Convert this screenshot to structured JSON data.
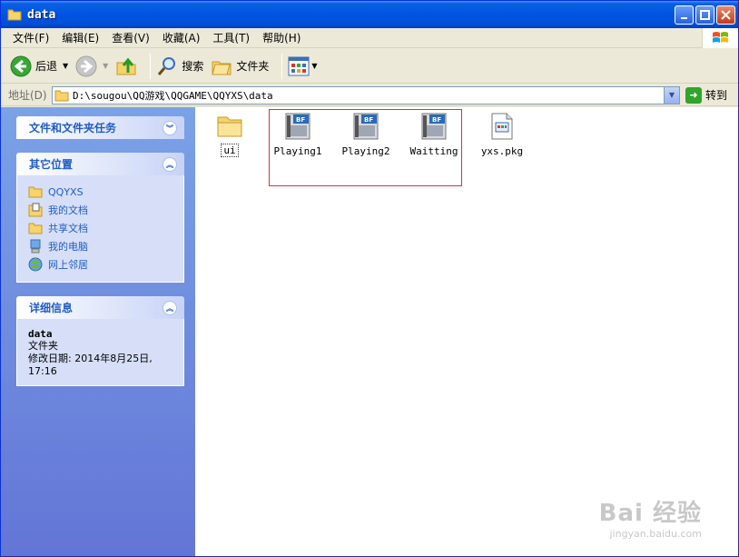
{
  "window": {
    "title": "data"
  },
  "menu": {
    "items": [
      "文件(F)",
      "编辑(E)",
      "查看(V)",
      "收藏(A)",
      "工具(T)",
      "帮助(H)"
    ]
  },
  "toolbar": {
    "back_label": "后退",
    "search_label": "搜索",
    "folders_label": "文件夹"
  },
  "address": {
    "label": "地址(D)",
    "path": "D:\\sougou\\QQ游戏\\QQGAME\\QQYXS\\data",
    "go_label": "转到"
  },
  "tasks_panel": {
    "title": "文件和文件夹任务"
  },
  "places_panel": {
    "title": "其它位置",
    "items": [
      {
        "label": "QQYXS",
        "icon": "folder-icon"
      },
      {
        "label": "我的文档",
        "icon": "my-documents-icon"
      },
      {
        "label": "共享文档",
        "icon": "shared-documents-icon"
      },
      {
        "label": "我的电脑",
        "icon": "my-computer-icon"
      },
      {
        "label": "网上邻居",
        "icon": "network-places-icon"
      }
    ]
  },
  "details_panel": {
    "title": "详细信息",
    "name": "data",
    "type": "文件夹",
    "modified_line1": "修改日期: 2014年8月25日,",
    "modified_line2": "17:16"
  },
  "files": [
    {
      "name": "ui",
      "icon": "folder-icon"
    },
    {
      "name": "Playing1",
      "icon": "bf-file-icon"
    },
    {
      "name": "Playing2",
      "icon": "bf-file-icon"
    },
    {
      "name": "Waitting",
      "icon": "bf-file-icon"
    },
    {
      "name": "yxs.pkg",
      "icon": "pkg-file-icon"
    }
  ],
  "watermark": {
    "main": "Bai 经验",
    "sub": "jingyan.baidu.com"
  },
  "colors": {
    "titlebar": "#0054e3",
    "pane": "#6375d6",
    "accent": "#215dc6",
    "highlight": "#e03030"
  }
}
